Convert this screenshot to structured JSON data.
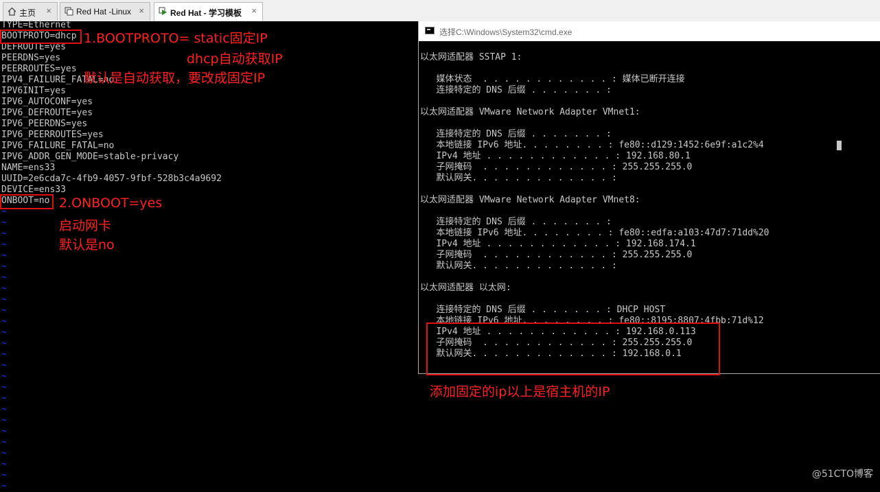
{
  "tabs": [
    {
      "label": "主页",
      "icon": "home-icon"
    },
    {
      "label": "Red Hat -Linux",
      "icon": "vm-icon"
    },
    {
      "label": "Red Hat - 学习模板",
      "icon": "vm-play-icon"
    }
  ],
  "tab_close": "×",
  "terminal": {
    "lines": [
      "TYPE=Ethernet",
      "BOOTPROTO=dhcp",
      "DEFROUTE=yes",
      "PEERDNS=yes",
      "PEERROUTES=yes",
      "IPV4_FAILURE_FATAL=no",
      "IPV6INIT=yes",
      "IPV6_AUTOCONF=yes",
      "IPV6_DEFROUTE=yes",
      "IPV6_PEERDNS=yes",
      "IPV6_PEERROUTES=yes",
      "IPV6_FAILURE_FATAL=no",
      "IPV6_ADDR_GEN_MODE=stable-privacy",
      "NAME=ens33",
      "UUID=2e6cda7c-4fb9-4057-9fbf-528b3c4a9692",
      "DEVICE=ens33",
      "ONBOOT=no"
    ],
    "tilde_lines": "~\n~\n~\n~\n~\n~\n~\n~\n~\n~\n~\n~\n~\n~\n~\n~\n~\n~\n~\n~\n~\n~\n~\n~\n~\n~"
  },
  "annotations": {
    "a1": "1.BOOTPROTO= static固定IP",
    "a2": "dhcp自动获取IP",
    "a3": "默认是自动获取，要改成固定IP",
    "a4": "2.ONBOOT=yes",
    "a5": "启动网卡",
    "a6": "默认是no",
    "a7": "添加固定的ip以上是宿主机的IP"
  },
  "cmd": {
    "title": "选择C:\\Windows\\System32\\cmd.exe",
    "output": "以太网适配器 SSTAP 1:\n\n   媒体状态  . . . . . . . . . . . . : 媒体已断开连接\n   连接特定的 DNS 后缀 . . . . . . . :\n\n以太网适配器 VMware Network Adapter VMnet1:\n\n   连接特定的 DNS 后缀 . . . . . . . :\n   本地链接 IPv6 地址. . . . . . . . : fe80::d129:1452:6e9f:a1c2%4\n   IPv4 地址 . . . . . . . . . . . . : 192.168.80.1\n   子网掩码  . . . . . . . . . . . . : 255.255.255.0\n   默认网关. . . . . . . . . . . . . :\n\n以太网适配器 VMware Network Adapter VMnet8:\n\n   连接特定的 DNS 后缀 . . . . . . . :\n   本地链接 IPv6 地址. . . . . . . . : fe80::edfa:a103:47d7:71dd%20\n   IPv4 地址 . . . . . . . . . . . . : 192.168.174.1\n   子网掩码  . . . . . . . . . . . . : 255.255.255.0\n   默认网关. . . . . . . . . . . . . :\n\n以太网适配器 以太网:\n\n   连接特定的 DNS 后缀 . . . . . . . : DHCP HOST\n   本地链接 IPv6 地址. . . . . . . . : fe80::8195:8807:4fbb:71d%12\n   IPv4 地址 . . . . . . . . . . . . : 192.168.0.113\n   子网掩码  . . . . . . . . . . . . : 255.255.255.0\n   默认网关. . . . . . . . . . . . . : 192.168.0.1"
  },
  "watermark": "@51CTO博客"
}
